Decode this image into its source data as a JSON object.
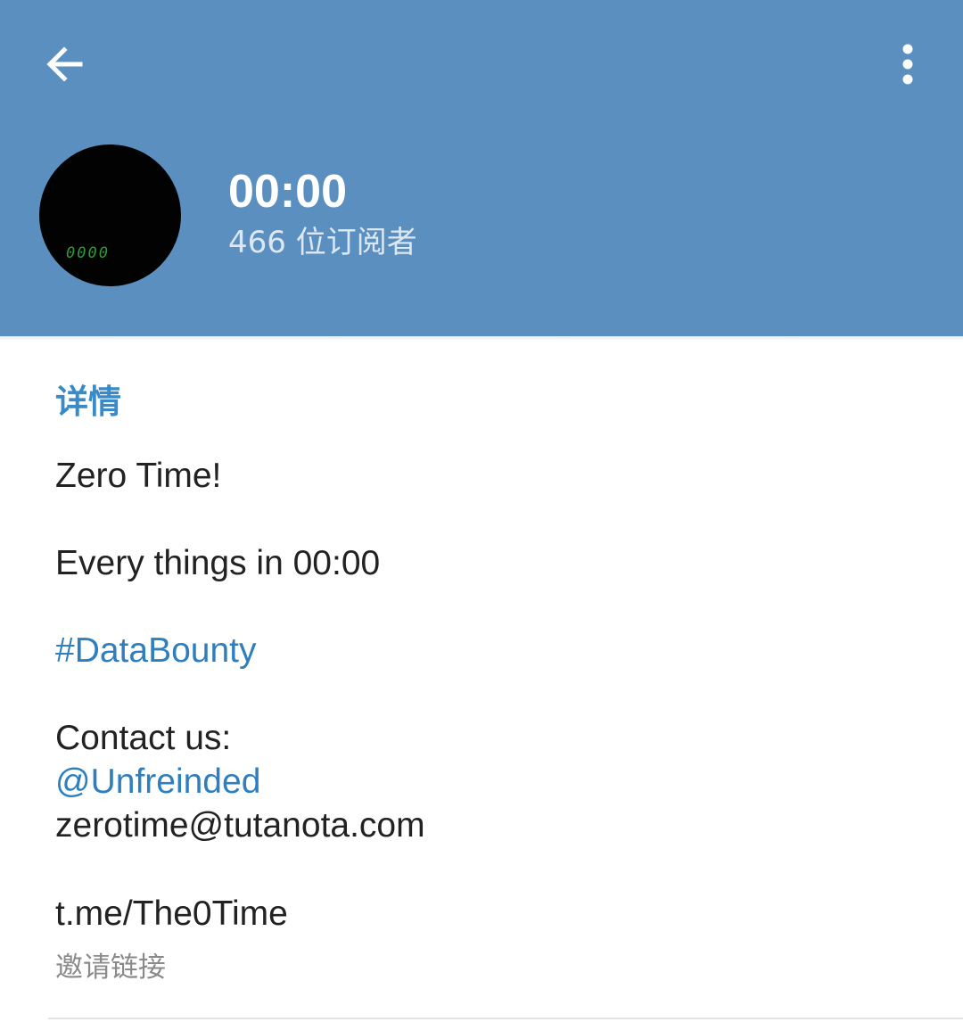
{
  "header": {
    "back_icon": "arrow-left-icon",
    "menu_icon": "more-vertical-icon",
    "title": "00:00",
    "subscribers": "466 位订阅者",
    "avatar_text": "0000",
    "background_color": "#5a8fbf"
  },
  "details": {
    "section_title": "详情",
    "line1": "Zero Time!",
    "line2": "Every things in 00:00",
    "hashtag": "#DataBounty",
    "contact_label": "Contact us:",
    "contact_username": "@Unfreinded",
    "contact_email": "zerotime@tutanota.com",
    "invite_link": "t.me/The0Time",
    "invite_label": "邀请链接",
    "link_color": "#2f7fbf",
    "accent_color": "#3a8ac7"
  }
}
